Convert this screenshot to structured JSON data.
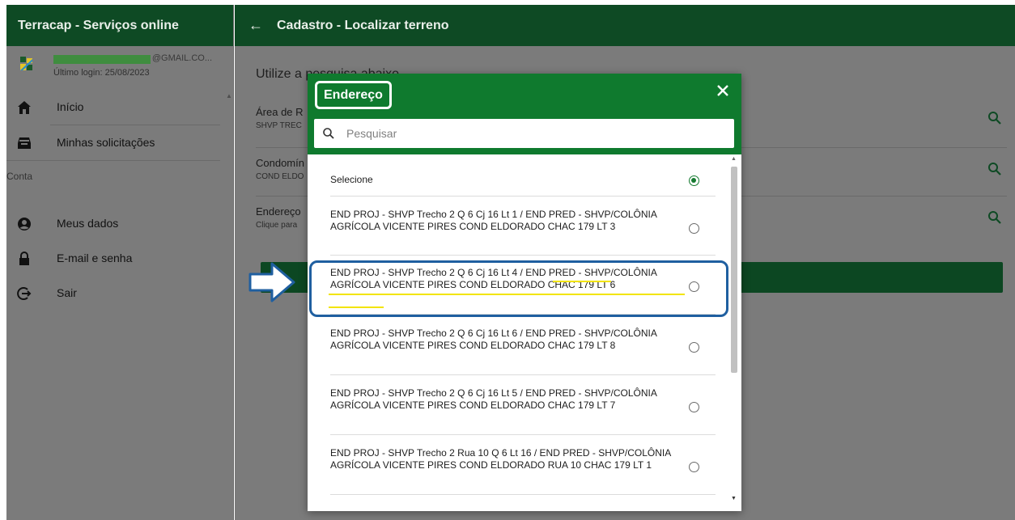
{
  "sidebar": {
    "title": "Terracap - Serviços online",
    "user_email": "@GMAIL.CO...",
    "last_login": "Último login: 25/08/2023",
    "items": [
      {
        "label": "Início",
        "icon": "home-icon"
      },
      {
        "label": "Minhas solicitações",
        "icon": "inbox-icon"
      }
    ],
    "section_label": "Conta",
    "account_items": [
      {
        "label": "Meus dados",
        "icon": "account-circle-icon"
      },
      {
        "label": "E-mail e senha",
        "icon": "lock-icon"
      },
      {
        "label": "Sair",
        "icon": "logout-icon"
      }
    ]
  },
  "header": {
    "back_icon": "arrow-left-icon",
    "title": "Cadastro - Localizar terreno"
  },
  "main": {
    "intro": "Utilize a pesquisa abaixo",
    "fields": [
      {
        "label": "Área de R",
        "value": "SHVP TREC"
      },
      {
        "label": "Condomín",
        "value": "COND ELDO"
      },
      {
        "label": "Endereço",
        "value": "Clique para"
      }
    ]
  },
  "dialog": {
    "title": "Endereço",
    "close_icon": "close-icon",
    "search_placeholder": "Pesquisar",
    "select_label": "Selecione",
    "options": [
      "END PROJ - SHVP Trecho 2 Q 6 Cj 16 Lt 1 / END PRED - SHVP/COLÔNIA AGRÍCOLA VICENTE PIRES COND ELDORADO CHAC 179 LT 3",
      "END PROJ - SHVP Trecho 2 Q 6 Cj 16 Lt 4 / END PRED - SHVP/COLÔNIA AGRÍCOLA VICENTE PIRES COND ELDORADO CHAC 179 LT 6",
      "END PROJ - SHVP Trecho 2 Q 6 Cj 16 Lt 6 / END PRED - SHVP/COLÔNIA AGRÍCOLA VICENTE PIRES COND ELDORADO CHAC 179 LT 8",
      "END PROJ - SHVP Trecho 2 Q 6 Cj 16 Lt 5 / END PRED - SHVP/COLÔNIA AGRÍCOLA VICENTE PIRES COND ELDORADO CHAC 179 LT 7",
      "END PROJ - SHVP Trecho 2 Rua 10 Q 6 Lt 16 / END PRED - SHVP/COLÔNIA AGRÍCOLA VICENTE PIRES COND ELDORADO RUA 10 CHAC 179 LT 1"
    ]
  },
  "colors": {
    "header_green": "#0e4a24",
    "dialog_green": "#0f7a2e",
    "accent_green": "#157a30",
    "annotation_blue": "#1f5fa0",
    "highlight_yellow": "#f2e400"
  }
}
